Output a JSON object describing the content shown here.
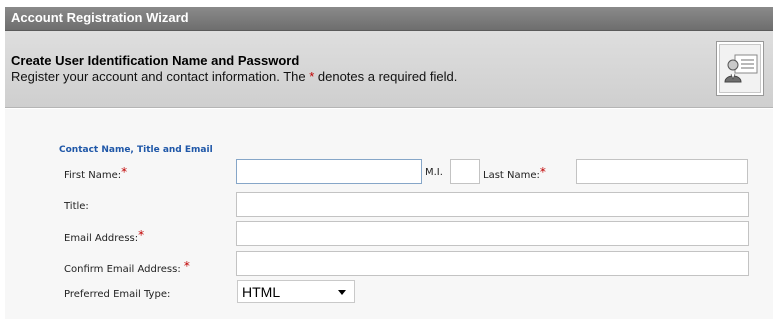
{
  "wizard": {
    "title": "Account Registration Wizard"
  },
  "header": {
    "heading": "Create User Identification Name and Password",
    "description_before": "Register your account and contact information. The ",
    "required_marker": "*",
    "description_after": " denotes a required field.",
    "icon": "user-card-icon"
  },
  "form": {
    "section_title": "Contact Name, Title and Email",
    "required_marker": "*",
    "first_name": {
      "label": "First Name:",
      "value": ""
    },
    "middle_initial": {
      "label": "M.I.",
      "value": ""
    },
    "last_name": {
      "label": "Last Name:",
      "value": ""
    },
    "title": {
      "label": "Title:",
      "value": ""
    },
    "email": {
      "label": "Email Address:",
      "value": ""
    },
    "confirm_email": {
      "label": "Confirm Email Address: ",
      "value": ""
    },
    "email_type": {
      "label": "Preferred Email Type:",
      "value": "HTML"
    }
  },
  "colors": {
    "section_title": "#1f57a8",
    "required": "#c00000",
    "title_bar": "#7a7a7a"
  }
}
